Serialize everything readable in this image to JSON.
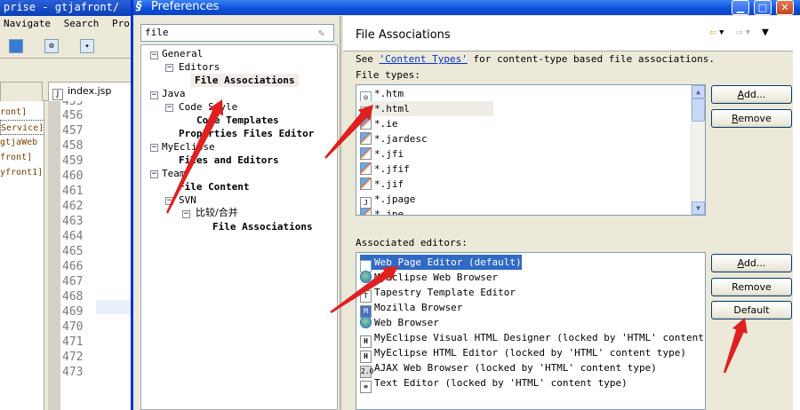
{
  "ide": {
    "title": "prise - gtjafront/",
    "menu": [
      "Navigate",
      "Search",
      "Proje"
    ],
    "left_items": [
      "ront]",
      "Service]",
      "gtjaWeb",
      "front]",
      "yfront1]"
    ],
    "tab_label": "index.jsp",
    "line_numbers": [
      "455",
      "456",
      "457",
      "458",
      "459",
      "460",
      "461",
      "462",
      "463",
      "464",
      "465",
      "466",
      "467",
      "468",
      "469",
      "470",
      "471",
      "472",
      "473"
    ]
  },
  "dialog": {
    "title": "Preferences",
    "search_value": "file",
    "tree": [
      {
        "label": "General",
        "bold": false
      },
      {
        "label": "Editors",
        "bold": false
      },
      {
        "label": "File Associations",
        "bold": true
      },
      {
        "label": "Java",
        "bold": false
      },
      {
        "label": "Code Style",
        "bold": false
      },
      {
        "label": "Code Templates",
        "bold": true
      },
      {
        "label": "Properties Files Editor",
        "bold": true
      },
      {
        "label": "MyEclipse",
        "bold": false
      },
      {
        "label": "Files and Editors",
        "bold": true
      },
      {
        "label": "Team",
        "bold": false
      },
      {
        "label": "File Content",
        "bold": true
      },
      {
        "label": "SVN",
        "bold": false
      },
      {
        "label": "比较/合并",
        "bold": false
      },
      {
        "label": "File Associations",
        "bold": true
      }
    ],
    "page": {
      "title": "File Associations",
      "see_prefix": "See ",
      "see_link": "'Content Types'",
      "see_suffix": " for content-type based file associations.",
      "file_types_label": "File types:",
      "file_types": [
        "*.htm",
        "*.html",
        "*.ie",
        "*.jardesc",
        "*.jfi",
        "*.jfif",
        "*.jif",
        "*.jpage",
        "*.jpe"
      ],
      "associated_label": "Associated editors:",
      "editors": [
        "Web Page Editor (default)",
        "MyEclipse Web Browser",
        "Tapestry Template Editor",
        "Mozilla Browser",
        "Web Browser",
        "MyEclipse Visual HTML Designer (locked by 'HTML' content type",
        "MyEclipse HTML Editor (locked by 'HTML' content type)",
        "AJAX Web Browser (locked by 'HTML' content type)",
        "Text Editor (locked by 'HTML' content type)"
      ],
      "buttons": {
        "add_types": "Add...",
        "remove_types": "Remove",
        "add_editors": "Add...",
        "remove_editors": "Remove",
        "default": "Default"
      }
    }
  },
  "annotation_color": "#e02020"
}
